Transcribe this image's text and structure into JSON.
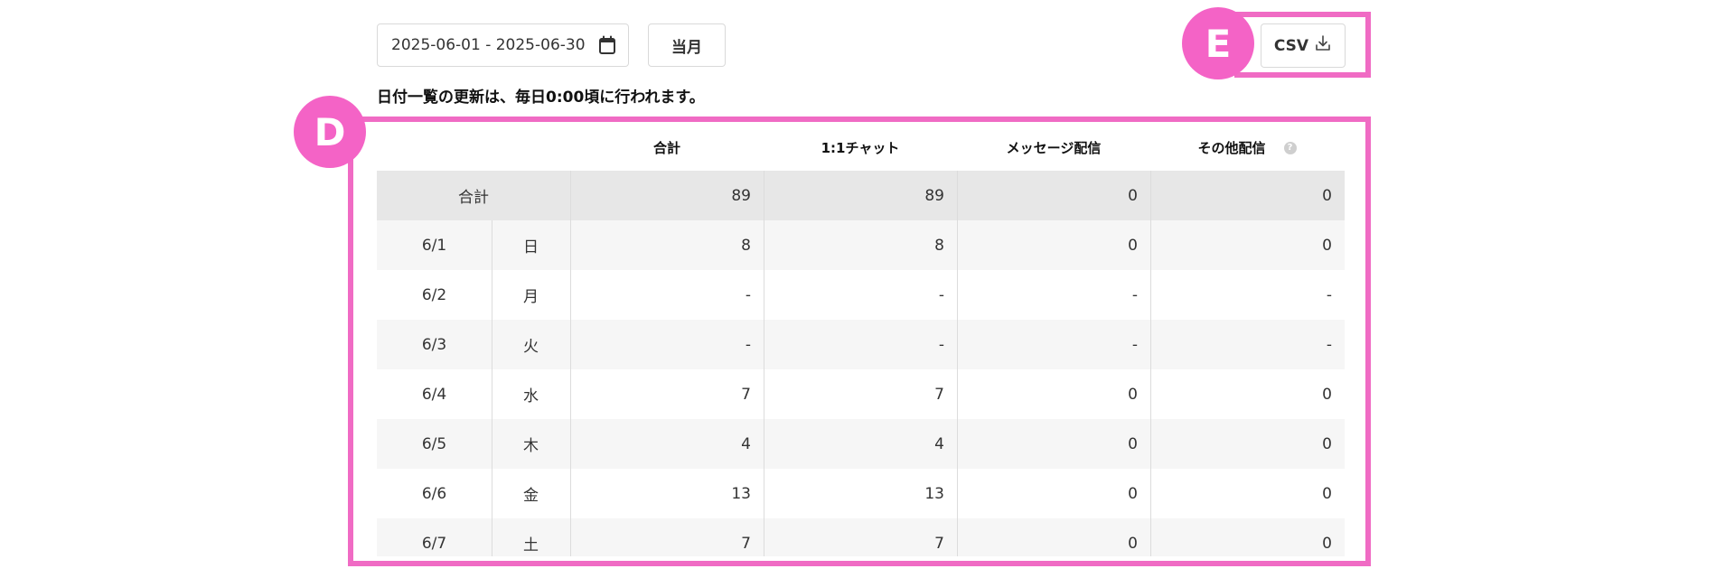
{
  "toolbar": {
    "date_range": "2025-06-01 - 2025-06-30",
    "current_month_label": "当月",
    "csv_label": "CSV",
    "notice": "日付一覧の更新は、毎日0:00頃に行われます。"
  },
  "annotations": {
    "table_badge": "D",
    "csv_badge": "E",
    "highlight_color": "#f06bc4"
  },
  "table": {
    "headers": {
      "total": "合計",
      "chat": "1:1チャット",
      "message": "メッセージ配信",
      "other": "その他配信"
    },
    "total_row": {
      "label": "合計",
      "total": "89",
      "chat": "89",
      "message": "0",
      "other": "0"
    },
    "rows": [
      {
        "date": "6/1",
        "dow": "日",
        "total": "8",
        "chat": "8",
        "message": "0",
        "other": "0"
      },
      {
        "date": "6/2",
        "dow": "月",
        "total": "-",
        "chat": "-",
        "message": "-",
        "other": "-"
      },
      {
        "date": "6/3",
        "dow": "火",
        "total": "-",
        "chat": "-",
        "message": "-",
        "other": "-"
      },
      {
        "date": "6/4",
        "dow": "水",
        "total": "7",
        "chat": "7",
        "message": "0",
        "other": "0"
      },
      {
        "date": "6/5",
        "dow": "木",
        "total": "4",
        "chat": "4",
        "message": "0",
        "other": "0"
      },
      {
        "date": "6/6",
        "dow": "金",
        "total": "13",
        "chat": "13",
        "message": "0",
        "other": "0"
      },
      {
        "date": "6/7",
        "dow": "土",
        "total": "7",
        "chat": "7",
        "message": "0",
        "other": "0"
      }
    ]
  }
}
